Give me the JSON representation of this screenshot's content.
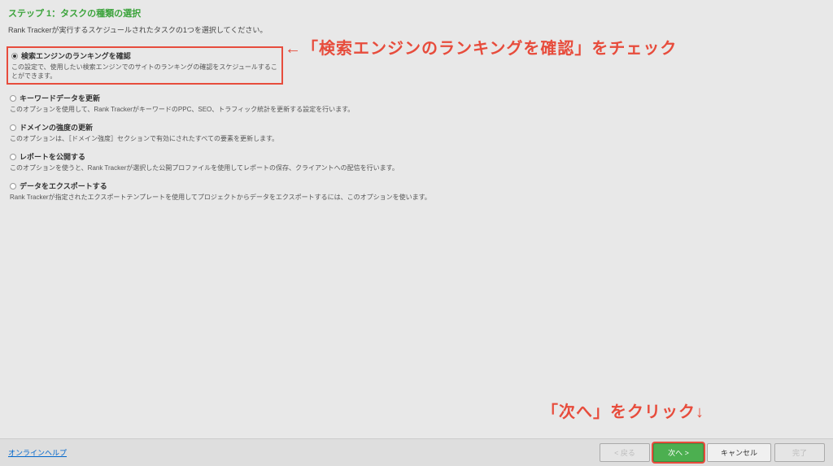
{
  "header": {
    "step_title": "ステップ 1：タスクの種類の選択",
    "step_desc": "Rank Trackerが実行するスケジュールされたタスクの1つを選択してください。"
  },
  "options": [
    {
      "title": "検索エンジンのランキングを確認",
      "desc": "この設定で、使用したい検索エンジンでのサイトのランキングの確認をスケジュールすることができます。",
      "selected": true
    },
    {
      "title": "キーワードデータを更新",
      "desc": "このオプションを使用して、Rank TrackerがキーワードのPPC、SEO、トラフィック統計を更新する設定を行います。"
    },
    {
      "title": "ドメインの強度の更新",
      "desc": "このオプションは、［ドメイン強度］セクションで有効にされたすべての要素を更新します。"
    },
    {
      "title": "レポートを公開する",
      "desc": "このオプションを使うと、Rank Trackerが選択した公開プロファイルを使用してレポートの保存、クライアントへの配信を行います。"
    },
    {
      "title": "データをエクスポートする",
      "desc": "Rank Trackerが指定されたエクスポートテンプレートを使用してプロジェクトからデータをエクスポートするには、このオプションを使います。"
    }
  ],
  "annotations": {
    "a1": "←「検索エンジンのランキングを確認」をチェック",
    "a2": "「次へ」をクリック↓"
  },
  "footer": {
    "help": "オンラインヘルプ",
    "back": "< 戻る",
    "next": "次へ >",
    "cancel": "キャンセル",
    "finish": "完了"
  }
}
